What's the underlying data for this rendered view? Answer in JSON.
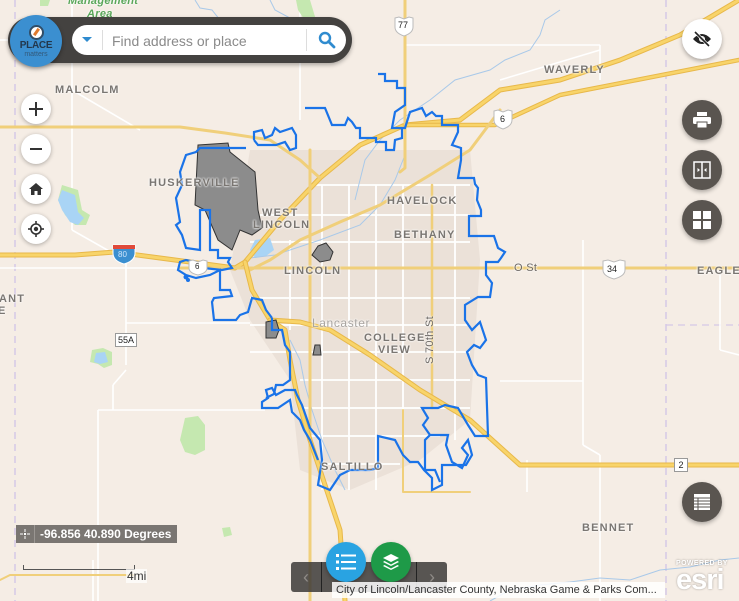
{
  "search": {
    "logo_line1": "PLACE",
    "logo_line2": "matters",
    "placeholder": "Find address or place",
    "value": ""
  },
  "controls": {
    "zoom_in": "zoom-in",
    "zoom_out": "zoom-out",
    "home": "home",
    "locate": "locate"
  },
  "right_toolbar": [
    "hide-visibility",
    "print",
    "compare",
    "apps"
  ],
  "map_labels": {
    "management_area_1": "Management",
    "management_area_2": "Area",
    "malcolm": "MALCOLM",
    "waverly": "WAVERLY",
    "huskerville": "HUSKERVILLE",
    "west": "WEST",
    "lincoln_west": "LINCOLN",
    "havelock": "HAVELOCK",
    "bethany": "BETHANY",
    "lincoln": "LINCOLN",
    "o_st": "O St",
    "eagle": "EAGLE",
    "ant": "ANT",
    "e": "E",
    "lancaster": "Lancaster",
    "college": "COLLEGE",
    "view": "VIEW",
    "s70th": "S 70th St",
    "saltillo": "SALTILLO",
    "bennet": "BENNET"
  },
  "shields": {
    "us77": "77",
    "us6_a": "6",
    "us6_b": "6",
    "i80": "80",
    "us34": "34",
    "ne55a": "55A",
    "ne2": "2"
  },
  "coordinates": {
    "text": "-96.856 40.890 Degrees"
  },
  "scalebar": {
    "label": "4mi"
  },
  "attribution": "City of Lincoln/Lancaster County, Nebraska Game & Parks Com...",
  "esri": {
    "powered_by": "POWERED BY",
    "name": "esri"
  },
  "colors": {
    "boundary": "#1a73e8",
    "highway": "#f6c545",
    "annex": "#8c8c8c",
    "water": "#a9d4f5",
    "park": "#c5e8b0",
    "legend_btn": "#29a3e2",
    "layers_btn": "#1e9a48"
  }
}
